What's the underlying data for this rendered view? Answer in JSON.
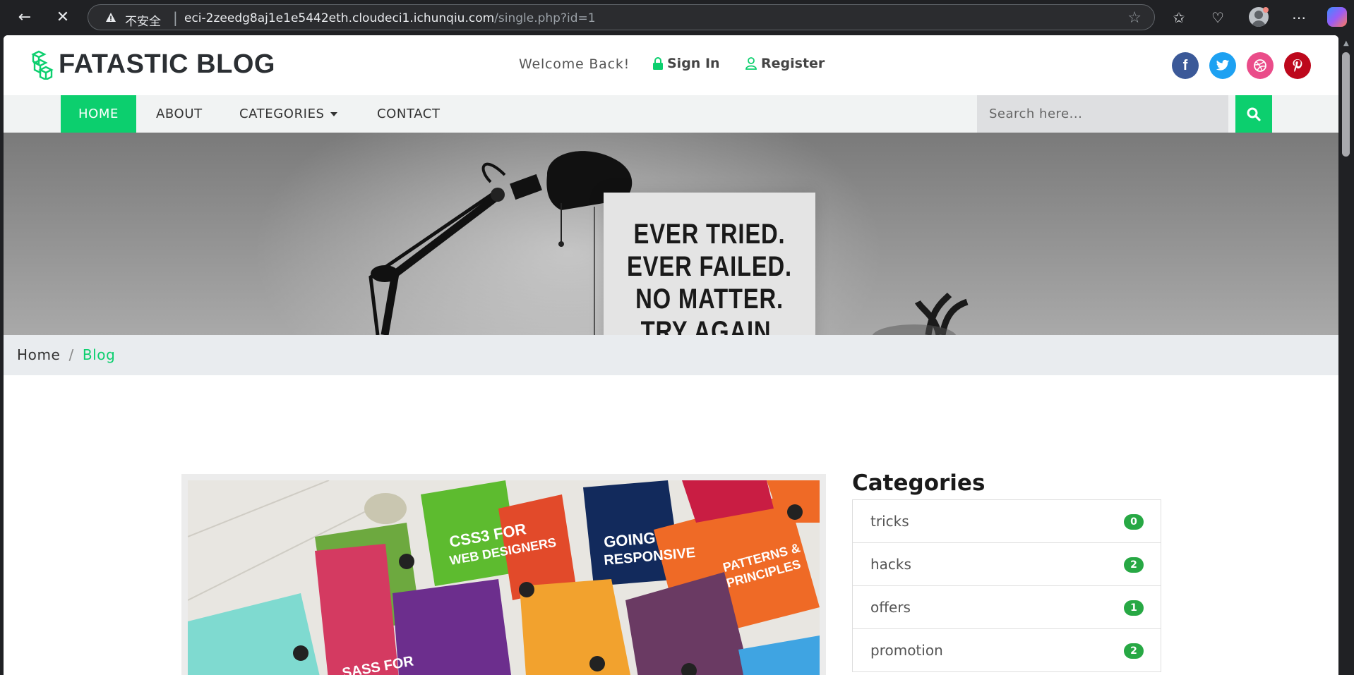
{
  "browser": {
    "security_label": "不安全",
    "url_host": "eci-2zeedg8aj1e1e5442eth.cloudeci1.ichunqiu.com",
    "url_path": "/single.php?id=1"
  },
  "header": {
    "logo_text": "FATASTIC BLOG",
    "welcome": "Welcome Back!",
    "signin": "Sign In",
    "register": "Register",
    "social": [
      {
        "name": "facebook",
        "glyph": "f",
        "color": "#3b5998"
      },
      {
        "name": "twitter",
        "glyph": "t",
        "color": "#1da1f2"
      },
      {
        "name": "dribbble",
        "glyph": "◎",
        "color": "#ea4c89"
      },
      {
        "name": "pinterest",
        "glyph": "p",
        "color": "#bd081c"
      }
    ]
  },
  "nav": {
    "items": [
      "HOME",
      "ABOUT",
      "CATEGORIES",
      "CONTACT"
    ],
    "search_placeholder": "Search here..."
  },
  "hero": {
    "poster_lines": [
      "EVER TRIED.",
      "EVER FAILED.",
      "NO MATTER.",
      "TRY AGAIN."
    ]
  },
  "breadcrumb": {
    "home": "Home",
    "separator": "/",
    "current": "Blog"
  },
  "sidebar": {
    "title": "Categories",
    "categories": [
      {
        "name": "tricks",
        "count": "0"
      },
      {
        "name": "hacks",
        "count": "2"
      },
      {
        "name": "offers",
        "count": "1"
      },
      {
        "name": "promotion",
        "count": "2"
      }
    ]
  },
  "colors": {
    "accent": "#0ccf6e",
    "badge": "#27a844"
  }
}
